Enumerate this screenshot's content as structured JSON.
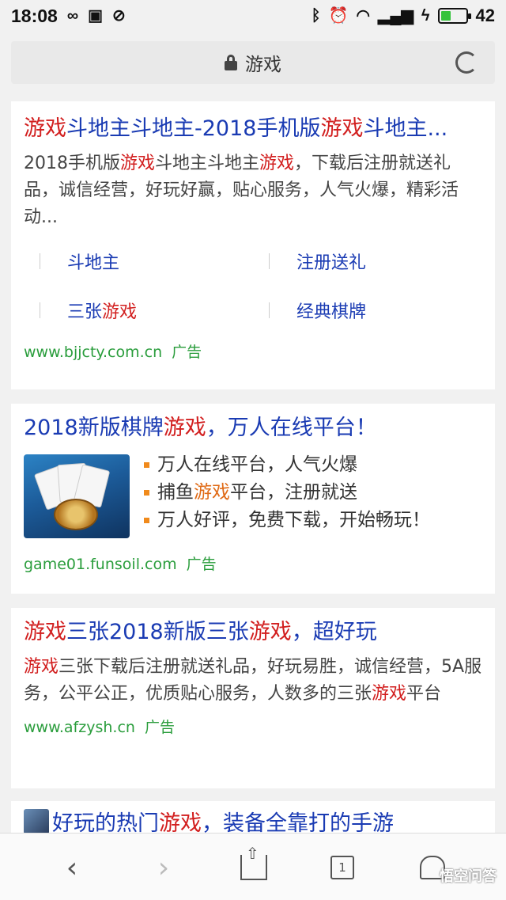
{
  "status_bar": {
    "time": "18:08",
    "battery_percent": "42",
    "battery_level": 0.42,
    "icons_left": [
      "infinity-icon",
      "notification-icon",
      "blocked-icon"
    ],
    "icons_right": [
      "bluetooth-icon",
      "alarm-icon",
      "wifi-icon",
      "signal-icon",
      "charging-icon"
    ]
  },
  "address_bar": {
    "title": "游戏",
    "icons": [
      "lock-icon",
      "reload-icon"
    ]
  },
  "results": [
    {
      "title": [
        {
          "text": "游戏",
          "hl": true
        },
        {
          "text": "斗地主斗地主-2018手机版",
          "hl": false
        },
        {
          "text": "游戏",
          "hl": true
        },
        {
          "text": "斗地主...",
          "hl": false
        }
      ],
      "description": [
        {
          "text": "2018手机版",
          "hl": false
        },
        {
          "text": "游戏",
          "hl": true
        },
        {
          "text": "斗地主斗地主",
          "hl": false
        },
        {
          "text": "游戏",
          "hl": true
        },
        {
          "text": "，下载后注册就送礼品，诚信经营，好玩好赢，贴心服务，人气火爆，精彩活动...",
          "hl": false
        }
      ],
      "sitelinks": [
        {
          "pre": "斗地主",
          "hl": "",
          "post": ""
        },
        {
          "pre": "注册送礼",
          "hl": "",
          "post": ""
        },
        {
          "pre": "三张",
          "hl": "游戏",
          "post": ""
        },
        {
          "pre": "经典棋牌",
          "hl": "",
          "post": ""
        }
      ],
      "url": "www.bjjcty.com.cn",
      "ad_label": "广告"
    },
    {
      "title": [
        {
          "text": "2018新版棋牌",
          "hl": false
        },
        {
          "text": "游戏",
          "hl": true
        },
        {
          "text": "，万人在线平台！",
          "hl": false
        }
      ],
      "bullets": [
        {
          "pre": "万人在线平台，人气火爆",
          "hl": "",
          "post": ""
        },
        {
          "pre": "捕鱼",
          "hl": "游戏",
          "post": "平台，注册就送"
        },
        {
          "pre": "万人好评，免费下载，开始畅玩！",
          "hl": "",
          "post": ""
        }
      ],
      "url": "game01.funsoil.com",
      "ad_label": "广告"
    },
    {
      "title": [
        {
          "text": "游戏",
          "hl": true
        },
        {
          "text": "三张2018新版三张",
          "hl": false
        },
        {
          "text": "游戏",
          "hl": true
        },
        {
          "text": "，超好玩",
          "hl": false
        }
      ],
      "description": [
        {
          "text": "游戏",
          "hl": true
        },
        {
          "text": "三张下载后注册就送礼品，好玩易胜，诚信经营，5A服务，公平公正，优质贴心服务，人数多的三张",
          "hl": false
        },
        {
          "text": "游戏",
          "hl": true
        },
        {
          "text": "平台",
          "hl": false
        }
      ],
      "url": "www.afzysh.cn",
      "ad_label": "广告"
    },
    {
      "title": [
        {
          "text": "好玩的热门",
          "hl": false
        },
        {
          "text": "游戏",
          "hl": true
        },
        {
          "text": "，装备全靠打的手游",
          "hl": false
        }
      ]
    }
  ],
  "bottom_nav": {
    "tab_count": "1",
    "icons": [
      "back-icon",
      "forward-icon",
      "share-icon",
      "tabs-icon",
      "home-icon"
    ],
    "watermark": "悟空问答"
  }
}
